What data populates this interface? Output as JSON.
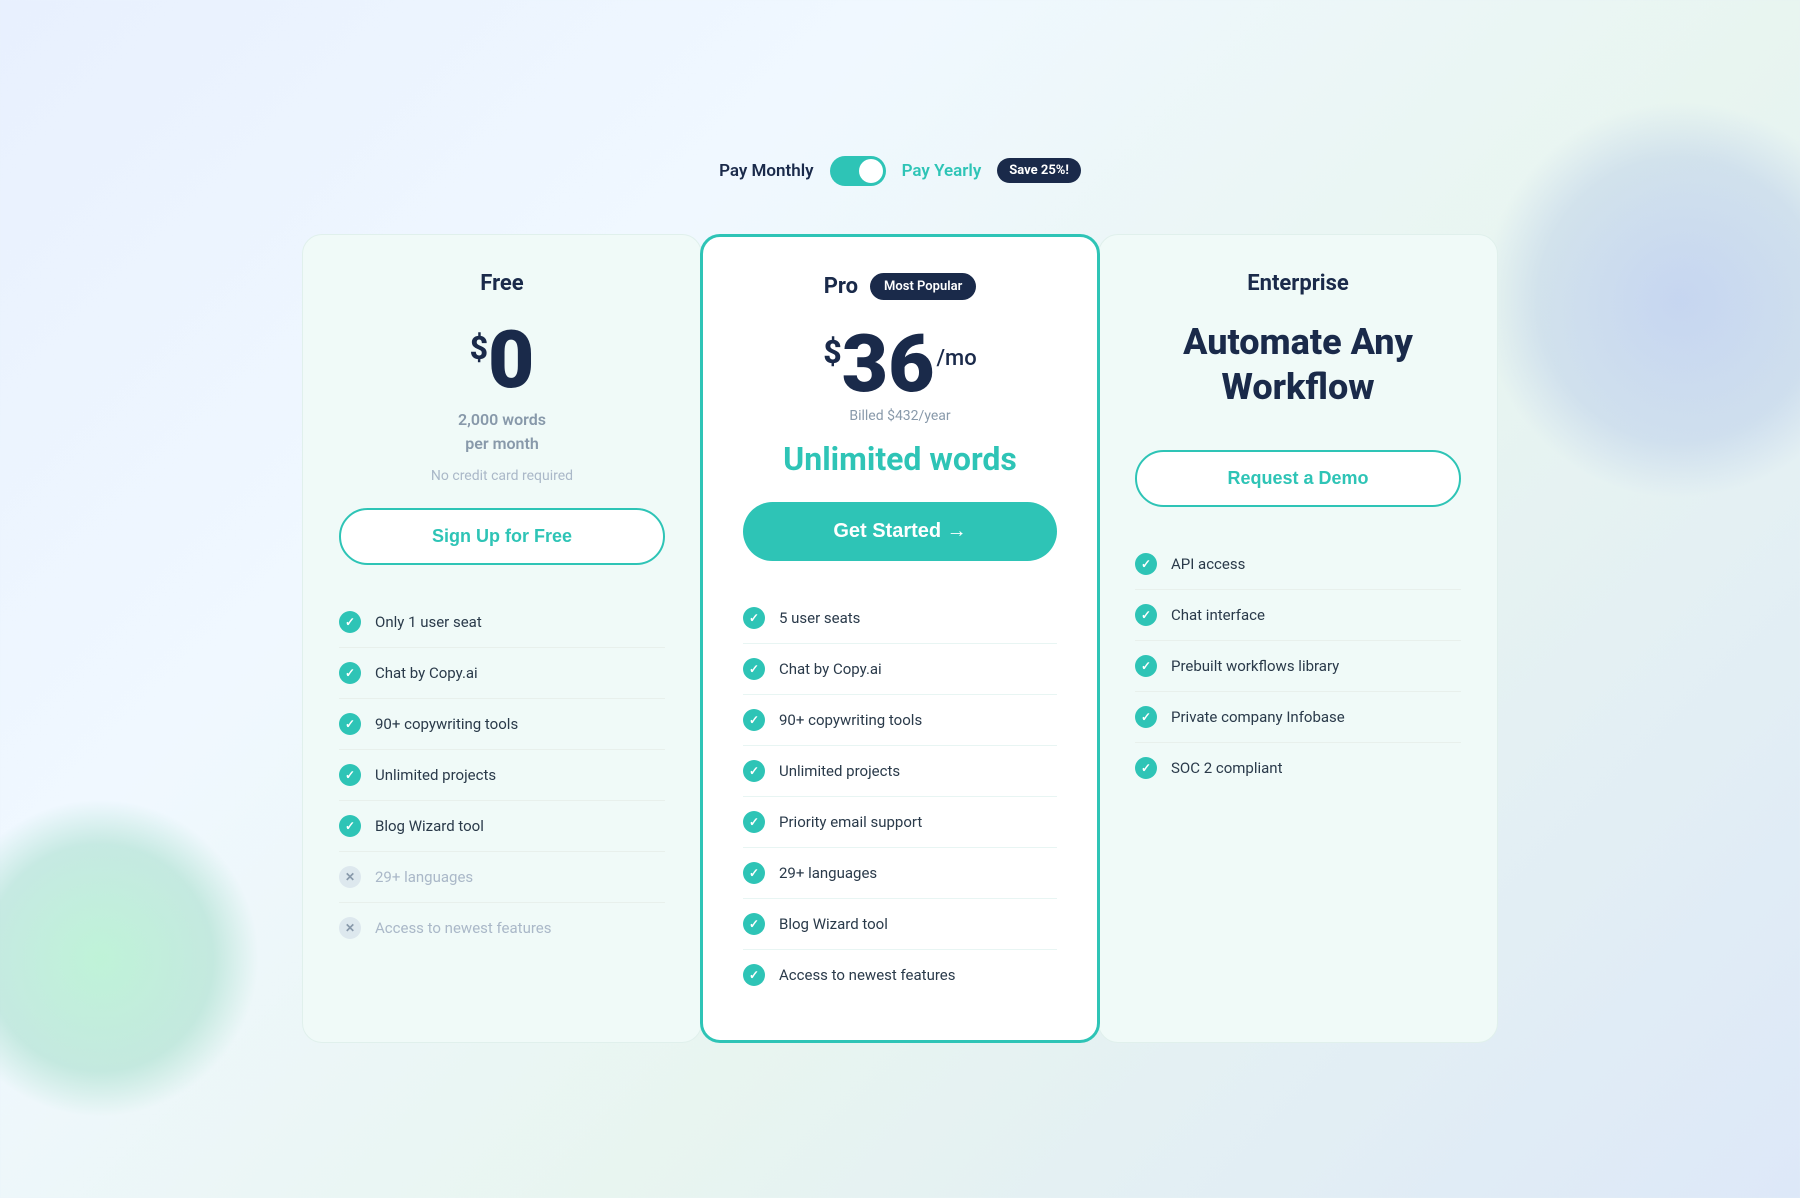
{
  "billing": {
    "monthly_label": "Pay Monthly",
    "yearly_label": "Pay Yearly",
    "save_badge": "Save 25%!"
  },
  "plans": {
    "free": {
      "title": "Free",
      "price": "0",
      "currency": "$",
      "words_line1": "2,000 words",
      "words_line2": "per month",
      "no_cc": "No credit card required",
      "cta": "Sign Up for Free",
      "features": [
        {
          "text": "Only 1 user seat",
          "enabled": true
        },
        {
          "text": "Chat by Copy.ai",
          "enabled": true
        },
        {
          "text": "90+ copywriting tools",
          "enabled": true
        },
        {
          "text": "Unlimited projects",
          "enabled": true
        },
        {
          "text": "Blog Wizard tool",
          "enabled": true
        },
        {
          "text": "29+ languages",
          "enabled": false
        },
        {
          "text": "Access to newest features",
          "enabled": false
        }
      ]
    },
    "pro": {
      "title": "Pro",
      "popular_badge": "Most Popular",
      "price": "36",
      "currency": "$",
      "period": "/mo",
      "billed": "Billed $432/year",
      "unlimited_words": "Unlimited words",
      "cta": "Get Started →",
      "features": [
        {
          "text": "5 user seats",
          "enabled": true
        },
        {
          "text": "Chat by Copy.ai",
          "enabled": true
        },
        {
          "text": "90+ copywriting tools",
          "enabled": true
        },
        {
          "text": "Unlimited projects",
          "enabled": true
        },
        {
          "text": "Priority email support",
          "enabled": true
        },
        {
          "text": "29+ languages",
          "enabled": true
        },
        {
          "text": "Blog Wizard tool",
          "enabled": true
        },
        {
          "text": "Access to newest features",
          "enabled": true
        }
      ]
    },
    "enterprise": {
      "title": "Enterprise",
      "tagline": "Automate Any Workflow",
      "cta": "Request a Demo",
      "features": [
        {
          "text": "API access",
          "enabled": true
        },
        {
          "text": "Chat interface",
          "enabled": true
        },
        {
          "text": "Prebuilt workflows library",
          "enabled": true
        },
        {
          "text": "Private company Infobase",
          "enabled": true
        },
        {
          "text": "SOC 2 compliant",
          "enabled": true
        }
      ]
    }
  }
}
